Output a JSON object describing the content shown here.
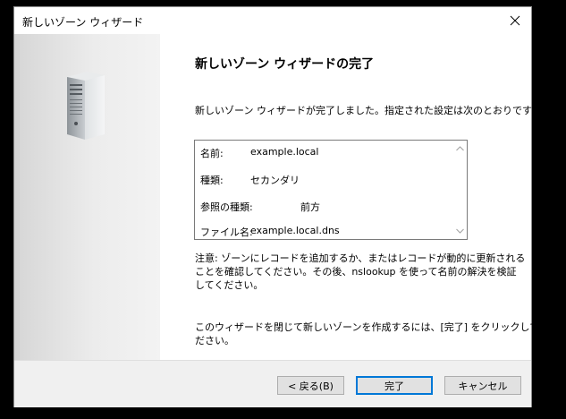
{
  "window": {
    "title": "新しいゾーン ウィザード"
  },
  "page": {
    "heading": "新しいゾーン ウィザードの完了",
    "intro": "新しいゾーン ウィザードが完了しました。指定された設定は次のとおりです:"
  },
  "summary": {
    "rows": [
      {
        "label": "名前:",
        "value": "example.local"
      },
      {
        "label": "種類:",
        "value": "セカンダリ"
      },
      {
        "label": "参照の種類:",
        "value": "前方"
      },
      {
        "label": "ファイル名:",
        "value": "example.local.dns"
      }
    ]
  },
  "note": {
    "lines": [
      "注意: ゾーンにレコードを追加するか、またはレコードが動的に更新される",
      "ことを確認してください。その後、nslookup を使って名前の解決を検証",
      "してください。"
    ]
  },
  "closing": {
    "lines": [
      "このウィザードを閉じて新しいゾーンを作成するには、[完了] をクリックしてく",
      "ださい。"
    ]
  },
  "buttons": {
    "back": "< 戻る(B)",
    "finish": "完了",
    "cancel": "キャンセル"
  },
  "icons": {
    "close": "close-icon",
    "server": "server-icon",
    "scroll_up": "scroll-up-arrow-icon",
    "scroll_down": "scroll-down-arrow-icon"
  },
  "colors": {
    "default_button_border": "#0078d7",
    "button_face": "#e1e1e1",
    "footer_background": "#f0f0f0"
  }
}
